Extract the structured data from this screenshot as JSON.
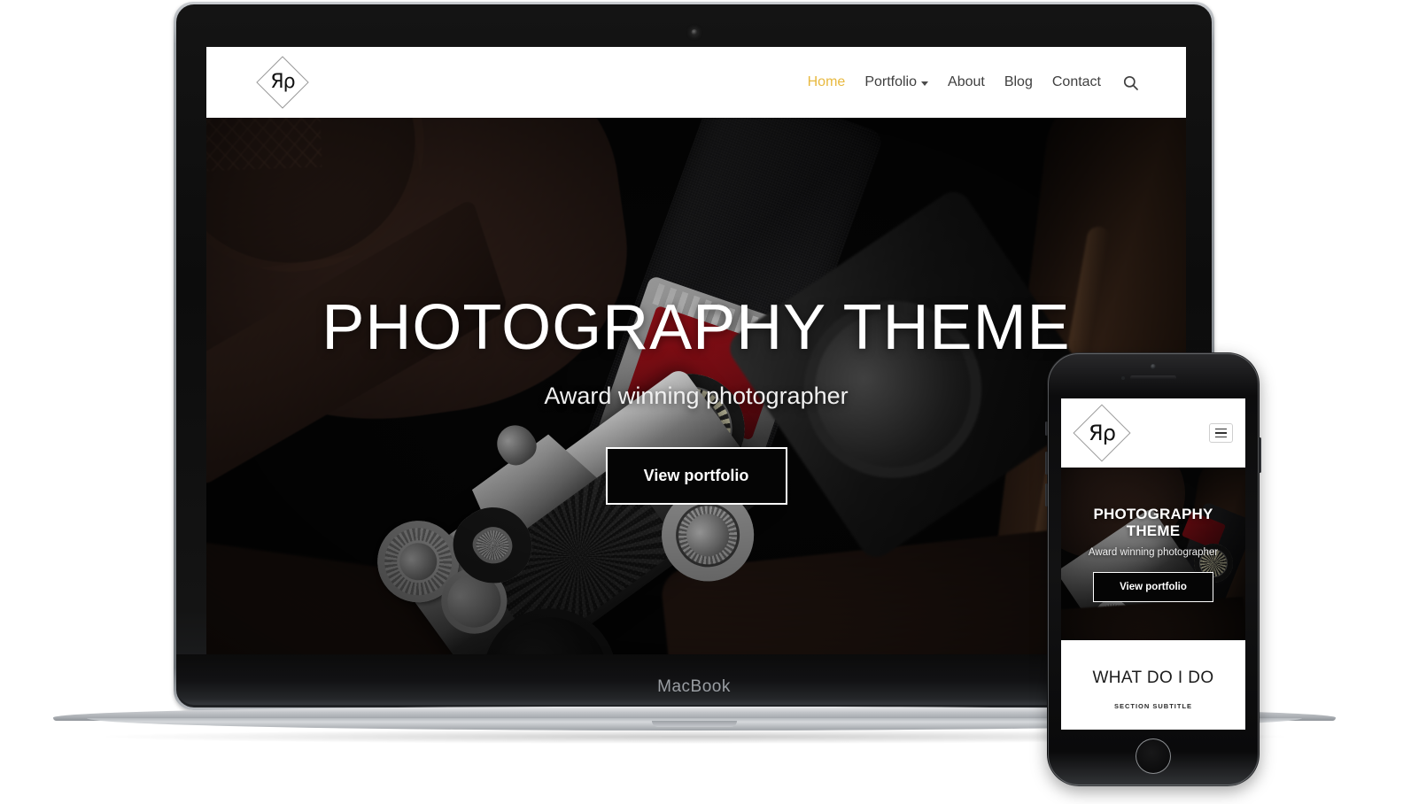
{
  "devices": {
    "laptop": {
      "brand_label": "MacBook",
      "camera_icon": "webcam-dot-icon"
    },
    "phone": {
      "home_button_icon": "home-button-icon",
      "speaker_icon": "earpiece-speaker-icon",
      "camera_icon": "front-camera-icon"
    }
  },
  "site": {
    "logo": {
      "mark": "Яρ",
      "shape": "diamond-outline"
    },
    "nav": {
      "items": [
        {
          "label": "Home",
          "active": true,
          "has_caret": false
        },
        {
          "label": "Portfolio",
          "active": false,
          "has_caret": true
        },
        {
          "label": "About",
          "active": false,
          "has_caret": false
        },
        {
          "label": "Blog",
          "active": false,
          "has_caret": false
        },
        {
          "label": "Contact",
          "active": false,
          "has_caret": false
        }
      ],
      "search_icon": "search-icon",
      "caret_icon": "chevron-down-icon",
      "active_color": "#e8b93f",
      "link_color": "#3f3f3f"
    },
    "hero": {
      "title": "PHOTOGRAPHY THEME",
      "subtitle": "Award winning photographer",
      "cta_label": "View portfolio",
      "background": "dark vintage cameras and leather case photograph"
    }
  },
  "mobile_site": {
    "logo": {
      "mark": "Яρ",
      "shape": "diamond-outline"
    },
    "menu_icon": "hamburger-menu-icon",
    "hero": {
      "title_line1": "PHOTOGRAPHY",
      "title_line2": "THEME",
      "subtitle": "Award winning photographer",
      "cta_label": "View portfolio"
    },
    "section": {
      "title": "WHAT DO I DO",
      "subtitle": "SECTION SUBTITLE"
    }
  }
}
